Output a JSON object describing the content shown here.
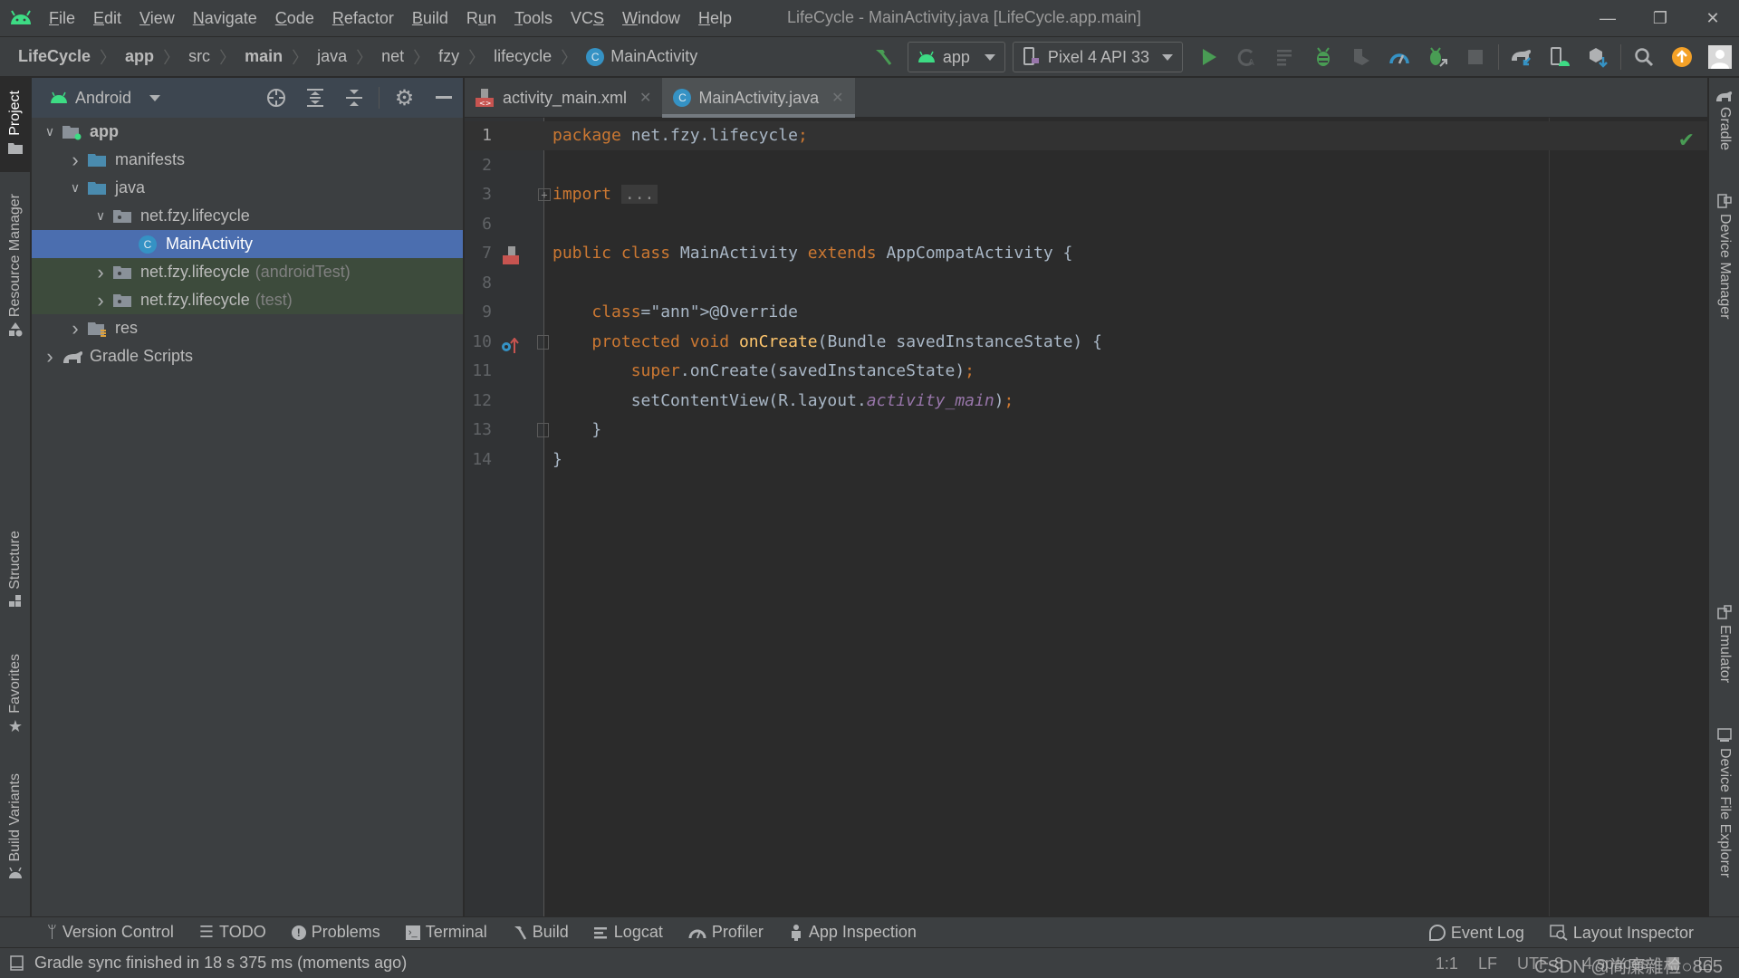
{
  "menubar": {
    "items": [
      {
        "label": "File",
        "mnemonic": 0
      },
      {
        "label": "Edit",
        "mnemonic": 0
      },
      {
        "label": "View",
        "mnemonic": 0
      },
      {
        "label": "Navigate",
        "mnemonic": 0
      },
      {
        "label": "Code",
        "mnemonic": 0
      },
      {
        "label": "Refactor",
        "mnemonic": 0
      },
      {
        "label": "Build",
        "mnemonic": 0
      },
      {
        "label": "Run",
        "mnemonic": 1
      },
      {
        "label": "Tools",
        "mnemonic": 0
      },
      {
        "label": "VCS",
        "mnemonic": 2
      },
      {
        "label": "Window",
        "mnemonic": 0
      },
      {
        "label": "Help",
        "mnemonic": 0
      }
    ],
    "window_title": "LifeCycle - MainActivity.java [LifeCycle.app.main]",
    "window_controls": {
      "minimize": "—",
      "restore": "❐",
      "close": "✕"
    }
  },
  "breadcrumb": {
    "items": [
      {
        "label": "LifeCycle",
        "bold": true
      },
      {
        "label": "app",
        "bold": true
      },
      {
        "label": "src",
        "bold": false
      },
      {
        "label": "main",
        "bold": true
      },
      {
        "label": "java",
        "bold": false
      },
      {
        "label": "net",
        "bold": false
      },
      {
        "label": "fzy",
        "bold": false
      },
      {
        "label": "lifecycle",
        "bold": false
      },
      {
        "label": "MainActivity",
        "bold": false,
        "icon": "class-icon"
      }
    ],
    "separator": "〉",
    "class_badge": "C"
  },
  "toolbar": {
    "run_config": "app",
    "device": "Pixel 4 API 33",
    "icons": [
      "hammer-icon",
      "run-icon",
      "apply-changes-icon",
      "apply-code-changes-icon",
      "debug-icon",
      "coverage-icon",
      "profile-icon",
      "attach-debugger-icon",
      "stop-icon",
      "gradle-sync-icon",
      "device-manager-icon",
      "sdk-manager-icon",
      "search-icon",
      "update-icon",
      "avatar-icon"
    ]
  },
  "left_stripe": {
    "tabs": [
      {
        "label": "Project",
        "active": true
      },
      {
        "label": "Resource Manager",
        "active": false
      },
      {
        "label": "Structure",
        "active": false
      },
      {
        "label": "Favorites",
        "active": false
      },
      {
        "label": "Build Variants",
        "active": false
      }
    ]
  },
  "project_panel": {
    "view_mode": "Android",
    "tree": [
      {
        "label": "app",
        "bold": true,
        "depth": 0,
        "expanded": true,
        "icon": "module-folder-icon"
      },
      {
        "label": "manifests",
        "depth": 1,
        "expanded": false,
        "icon": "folder-icon"
      },
      {
        "label": "java",
        "depth": 1,
        "expanded": true,
        "icon": "folder-icon"
      },
      {
        "label": "net.fzy.lifecycle",
        "depth": 2,
        "expanded": true,
        "icon": "package-icon"
      },
      {
        "label": "MainActivity",
        "depth": 3,
        "selected": true,
        "icon": "class-icon"
      },
      {
        "label": "net.fzy.lifecycle",
        "suffix": "(androidTest)",
        "depth": 2,
        "expanded": false,
        "icon": "package-icon",
        "test": true
      },
      {
        "label": "net.fzy.lifecycle",
        "suffix": "(test)",
        "depth": 2,
        "expanded": false,
        "icon": "package-icon",
        "test": true
      },
      {
        "label": "res",
        "depth": 1,
        "expanded": false,
        "icon": "res-folder-icon"
      },
      {
        "label": "Gradle Scripts",
        "depth": 0,
        "expanded": false,
        "icon": "gradle-icon"
      }
    ]
  },
  "editor": {
    "tabs": [
      {
        "label": "activity_main.xml",
        "active": false,
        "icon": "xml-layout-icon"
      },
      {
        "label": "MainActivity.java",
        "active": true,
        "icon": "class-icon"
      }
    ],
    "lines": [
      {
        "num": "1",
        "text": "package net.fzy.lifecycle;",
        "current": true
      },
      {
        "num": "2",
        "text": ""
      },
      {
        "num": "3",
        "text": "import ..."
      },
      {
        "num": "6",
        "text": ""
      },
      {
        "num": "7",
        "text": "public class MainActivity extends AppCompatActivity {"
      },
      {
        "num": "8",
        "text": ""
      },
      {
        "num": "9",
        "text": "    @Override"
      },
      {
        "num": "10",
        "text": "    protected void onCreate(Bundle savedInstanceState) {"
      },
      {
        "num": "11",
        "text": "        super.onCreate(savedInstanceState);"
      },
      {
        "num": "12",
        "text": "        setContentView(R.layout.activity_main);"
      },
      {
        "num": "13",
        "text": "    }"
      },
      {
        "num": "14",
        "text": "}"
      }
    ]
  },
  "right_stripe": {
    "tabs": [
      "Gradle",
      "Device Manager",
      "Emulator",
      "Device File Explorer"
    ]
  },
  "bottom_tools": {
    "left": [
      "Version Control",
      "TODO",
      "Problems",
      "Terminal",
      "Build",
      "Logcat",
      "Profiler",
      "App Inspection"
    ],
    "right": [
      "Event Log",
      "Layout Inspector"
    ]
  },
  "statusbar": {
    "message": "Gradle sync finished in 18 s 375 ms (moments ago)",
    "position": "1:1",
    "line_sep": "LF",
    "encoding": "UTF-8",
    "indent": "4 spaces",
    "watermark": "CSDN @尚廉雜检○865"
  },
  "colors": {
    "android_green": "#3ddc84",
    "selection": "#4b6eaf",
    "keyword": "#cc7832",
    "annotation": "#bbb529",
    "method": "#ffc66d",
    "field": "#9876aa",
    "class_badge": "#3592c4"
  }
}
